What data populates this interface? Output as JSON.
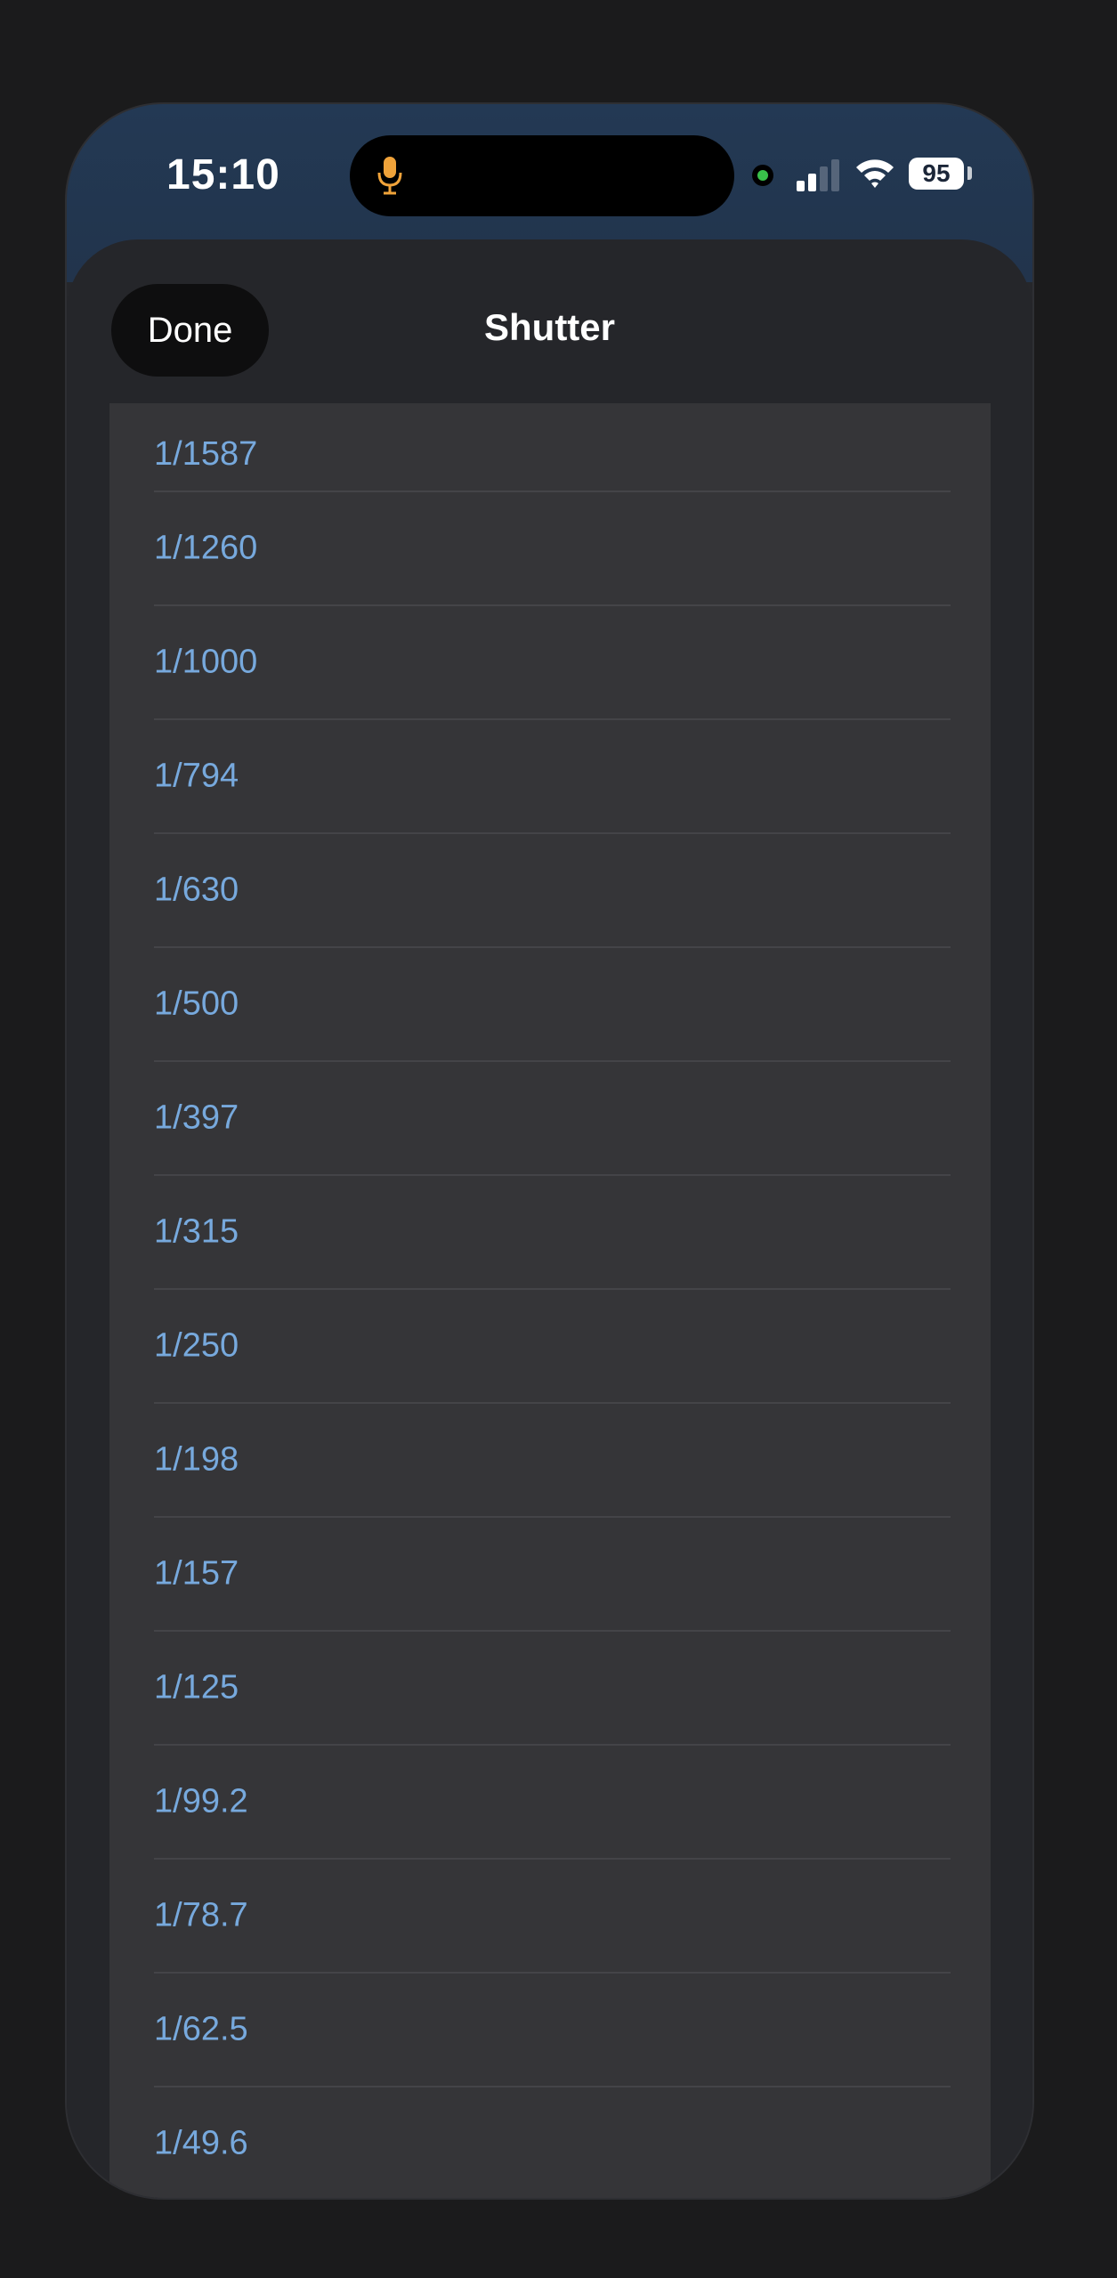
{
  "status_bar": {
    "time": "15:10",
    "battery": "95",
    "icons": [
      "microphone-icon",
      "camera-indicator-dot",
      "cellular-signal-icon",
      "wifi-icon",
      "battery-icon"
    ]
  },
  "header": {
    "done_label": "Done",
    "title": "Shutter"
  },
  "shutter_speeds": [
    "1/1587",
    "1/1260",
    "1/1000",
    "1/794",
    "1/630",
    "1/500",
    "1/397",
    "1/315",
    "1/250",
    "1/198",
    "1/157",
    "1/125",
    "1/99.2",
    "1/78.7",
    "1/62.5",
    "1/49.6"
  ],
  "colors": {
    "status_bar_bg": "#233954",
    "value_text": "#77a9dd",
    "mic_indicator": "#f0a33a",
    "camera_dot": "#39c04a"
  }
}
